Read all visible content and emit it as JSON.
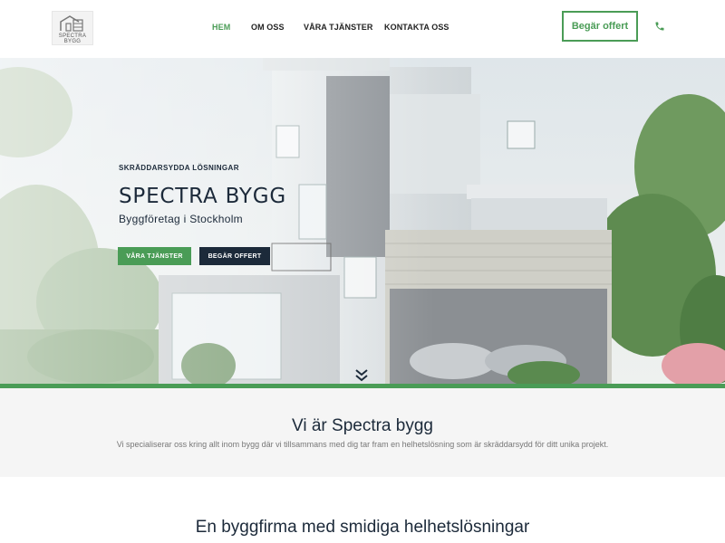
{
  "brand": {
    "logo_line1": "SPECTRA",
    "logo_line2": "BYGG",
    "accent_color": "#4a9c56",
    "dark_color": "#1c2a3a"
  },
  "nav": {
    "items": [
      {
        "label": "HEM",
        "active": true
      },
      {
        "label": "OM OSS",
        "active": false
      },
      {
        "label": "VÅRA TJÄNSTER",
        "active": false
      },
      {
        "label": "KONTAKTA OSS",
        "active": false
      }
    ],
    "offer_label": "Begär offert",
    "phone_icon": "phone-icon"
  },
  "hero": {
    "kicker": "SKRÄDDARSYDDA LÖSNINGAR",
    "title": "SPECTRA BYGG",
    "subtitle": "Byggföretag i Stockholm",
    "primary_button": "VÅRA TJÄNSTER",
    "secondary_button": "BEGÄR OFFERT",
    "scroll_icon": "chevron-down-icon"
  },
  "intro": {
    "title": "Vi är Spectra bygg",
    "text": "Vi specialiserar oss kring allt inom bygg där vi tillsammans med dig tar fram en helhetslösning som är skräddarsydd för ditt unika projekt."
  },
  "section2": {
    "title": "En byggfirma med smidiga helhetslösningar"
  }
}
